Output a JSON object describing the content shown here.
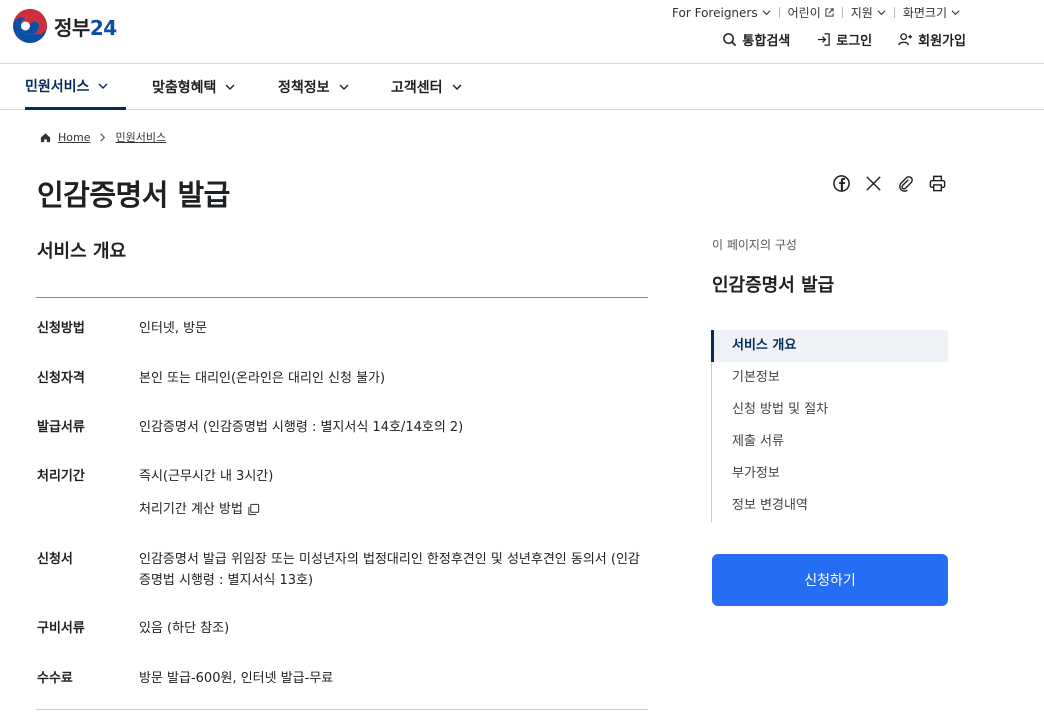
{
  "header": {
    "logo_text": "정부",
    "logo_num": "24",
    "utility": [
      {
        "label": "For Foreigners",
        "icon": "chevron-down-icon"
      },
      {
        "label": "어린이",
        "icon": "external-link-icon"
      },
      {
        "label": "지원",
        "icon": "chevron-down-icon"
      },
      {
        "label": "화면크기",
        "icon": "chevron-down-icon"
      }
    ],
    "topnav": [
      {
        "label": "통합검색",
        "icon": "search-icon"
      },
      {
        "label": "로그인",
        "icon": "login-icon"
      },
      {
        "label": "회원가입",
        "icon": "user-plus-icon"
      }
    ]
  },
  "gnb": [
    "민원서비스",
    "맞춤형혜택",
    "정책정보",
    "고객센터"
  ],
  "breadcrumb": {
    "home": "Home",
    "current": "민원서비스"
  },
  "page_title": "인감증명서 발급",
  "section_title": "서비스 개요",
  "info": [
    {
      "label": "신청방법",
      "value": "인터넷, 방문"
    },
    {
      "label": "신청자격",
      "value": "본인 또는 대리인(온라인은 대리인 신청 불가)"
    },
    {
      "label": "발급서류",
      "value": "인감증명서 (인감증명법 시행령 : 별지서식 14호/14호의 2)"
    },
    {
      "label": "처리기간",
      "value": "즉시(근무시간 내 3시간)",
      "sub": "처리기간 계산 방법"
    },
    {
      "label": "신청서",
      "value": "인감증명서 발급 위임장 또는 미성년자의 법정대리인 한정후견인 및 성년후견인 동의서 (인감증명법 시행령 : 별지서식 13호)"
    },
    {
      "label": "구비서류",
      "value": "있음 (하단 참조)"
    },
    {
      "label": "수수료",
      "value": "방문 발급-600원, 인터넷 발급-무료"
    }
  ],
  "sidebar": {
    "caption": "이 페이지의 구성",
    "title": "인감증명서 발급",
    "toc": [
      "서비스 개요",
      "기본정보",
      "신청 방법 및 절차",
      "제출 서류",
      "부가정보",
      "정보 변경내역"
    ],
    "apply_label": "신청하기"
  },
  "colors": {
    "primary": "#256ef4",
    "navy": "#052b57"
  }
}
